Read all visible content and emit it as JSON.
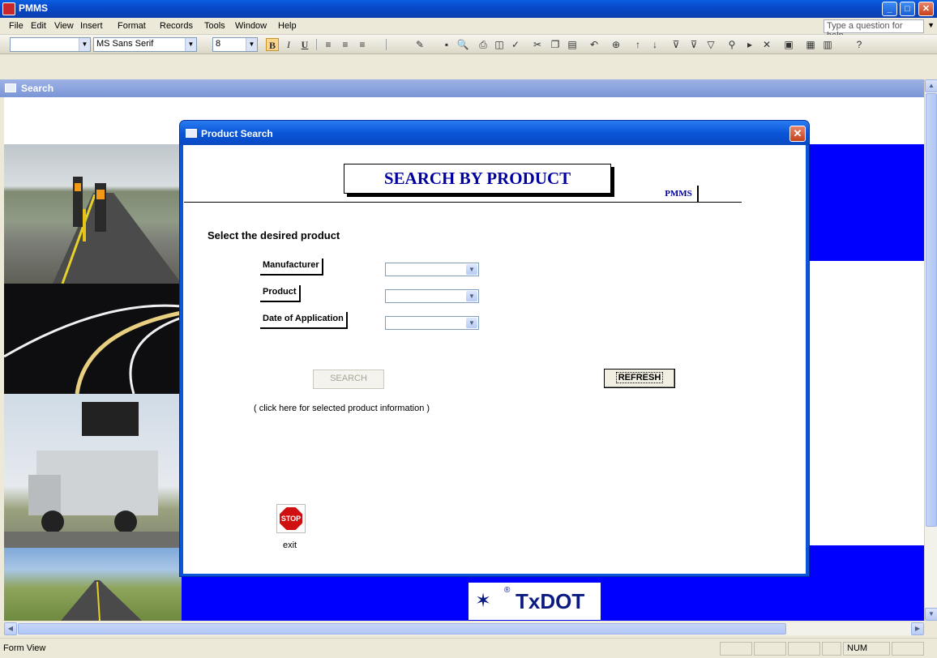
{
  "window": {
    "title": "PMMS",
    "min": "_",
    "max": "□",
    "close": "✕"
  },
  "menu": {
    "items": [
      "File",
      "Edit",
      "View",
      "Insert",
      "Format",
      "Records",
      "Tools",
      "Window",
      "Help"
    ],
    "help_placeholder": "Type a question for help"
  },
  "toolbar": {
    "font_name": "MS Sans Serif",
    "font_size": "8",
    "bold": "B",
    "italic": "I",
    "underline": "U"
  },
  "mdi": {
    "title": "Search"
  },
  "dialog": {
    "title": "Product Search",
    "heading": "SEARCH BY PRODUCT",
    "badge": "PMMS",
    "prompt": "Select the desired product",
    "fields": [
      {
        "label": "Manufacturer",
        "value": ""
      },
      {
        "label": "Product",
        "value": ""
      },
      {
        "label": "Date of Application",
        "value": ""
      }
    ],
    "search_button": "SEARCH",
    "refresh_button": "REFRESH",
    "hint": "( click here for selected product information )",
    "stop_icon_text": "STOP",
    "exit_label": "exit"
  },
  "logo": {
    "name": "TxDOT",
    "reg": "®"
  },
  "status": {
    "left": "Form View",
    "num": "NUM"
  },
  "colors": {
    "accent_blue": "#0000ff",
    "title_blue": "#0a56d8",
    "heading_text": "#0000a0"
  }
}
